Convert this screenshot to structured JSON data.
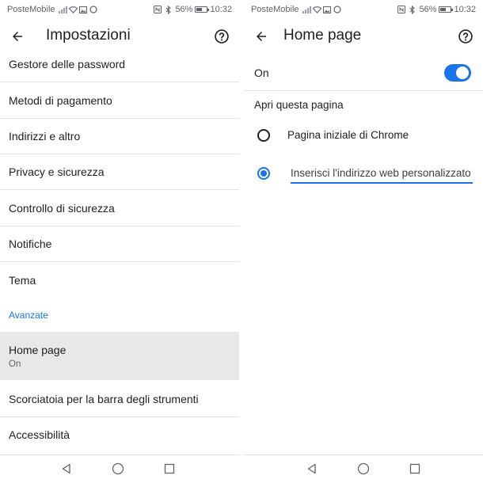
{
  "status_bar": {
    "carrier": "PosteMobile",
    "battery_percent": "56%",
    "time": "10:32",
    "battery_level": 0.56
  },
  "left": {
    "title": "Impostazioni",
    "items": [
      {
        "label": "Gestore delle password"
      },
      {
        "label": "Metodi di pagamento"
      },
      {
        "label": "Indirizzi e altro"
      },
      {
        "label": "Privacy e sicurezza"
      },
      {
        "label": "Controllo di sicurezza"
      },
      {
        "label": "Notifiche"
      },
      {
        "label": "Tema"
      }
    ],
    "section_header": "Avanzate",
    "advanced_items": [
      {
        "label": "Home page",
        "sublabel": "On"
      },
      {
        "label": "Scorciatoia per la barra degli strumenti"
      },
      {
        "label": "Accessibilità"
      }
    ]
  },
  "right": {
    "title": "Home page",
    "toggle_label": "On",
    "toggle_on": true,
    "group_label": "Apri questa pagina",
    "option_chrome": "Pagina iniziale di Chrome",
    "option_custom_value": "Inserisci l'indirizzo web personalizzato",
    "selected_option": "custom"
  },
  "colors": {
    "accent": "#1a73e8",
    "highlight_bg": "#e8e8e8",
    "divider": "#e3e3e3",
    "text_primary": "#202124",
    "text_secondary": "#5f6368"
  },
  "icons": {
    "back": "arrow-back-icon",
    "help": "help-circle-icon",
    "nav_back": "triangle-back-icon",
    "nav_home": "circle-home-icon",
    "nav_recents": "square-recents-icon"
  }
}
